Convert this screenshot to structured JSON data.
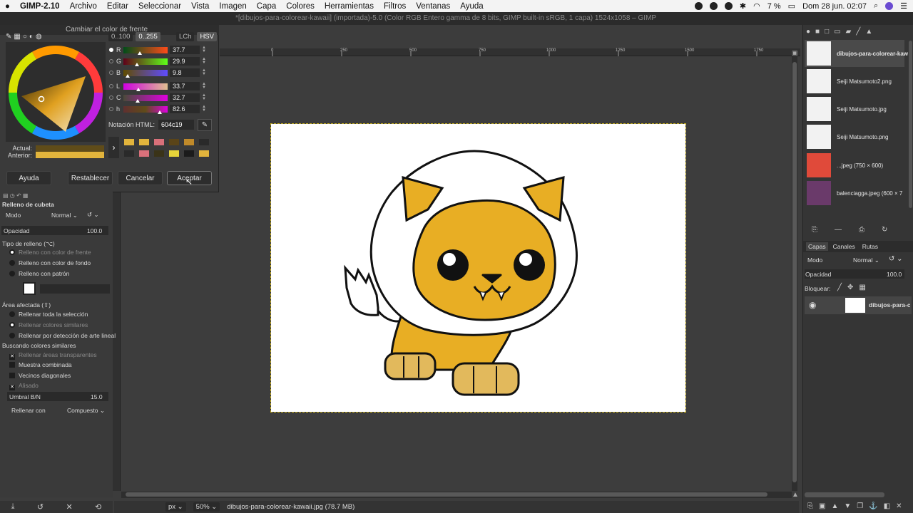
{
  "menubar": {
    "apple": "",
    "app": "GIMP-2.10",
    "items": [
      "Archivo",
      "Editar",
      "Seleccionar",
      "Vista",
      "Imagen",
      "Capa",
      "Colores",
      "Herramientas",
      "Filtros",
      "Ventanas",
      "Ayuda"
    ],
    "battery": "7 %",
    "datetime": "Dom 28 jun.  02:07"
  },
  "window_title": "*[dibujos-para-colorear-kawaii] (importada)-5.0 (Color RGB Entero gamma de 8 bits, GIMP built-in sRGB, 1 capa) 1524x1058 – GIMP",
  "ruler_ticks": [
    "0",
    "250",
    "500",
    "750",
    "1000",
    "1250",
    "1500",
    "1750"
  ],
  "color_dialog": {
    "title": "Cambiar el color de frente",
    "range_buttons": [
      "0..100",
      "0..255"
    ],
    "mode_buttons": [
      "LCh",
      "HSV"
    ],
    "channels": [
      {
        "label": "R",
        "value": "37.7",
        "fill": 0.377
      },
      {
        "label": "G",
        "value": "29.9",
        "fill": 0.299
      },
      {
        "label": "B",
        "value": "9.8",
        "fill": 0.098
      },
      {
        "label": "L",
        "value": "33.7",
        "fill": 0.337
      },
      {
        "label": "C",
        "value": "32.7",
        "fill": 0.327
      },
      {
        "label": "h",
        "value": "82.6",
        "fill": 0.826
      }
    ],
    "html_label": "Notación HTML:",
    "html_value": "604c19",
    "current_label": "Actual:",
    "previous_label": "Anterior:",
    "current_color": "#604c19",
    "previous_color": "#e2b43c",
    "history_colors": [
      "#e2b43c",
      "#e2b43c",
      "#d9707a",
      "#5a4418",
      "#c08a2a",
      "#2a2a2a",
      "#2a2a2a",
      "#d9707a",
      "#3a3318",
      "#e6d43a",
      "#1b1b1b",
      "#e2b43c"
    ],
    "buttons": {
      "help": "Ayuda",
      "reset": "Restablecer",
      "cancel": "Cancelar",
      "ok": "Aceptar"
    }
  },
  "tool_options": {
    "title": "Relleno de cubeta",
    "mode_label": "Modo",
    "mode_value": "Normal",
    "opacity_label": "Opacidad",
    "opacity_value": "100.0",
    "fill_type_label": "Tipo de relleno  (⌥)",
    "fill_types": [
      "Relleno con color de frente",
      "Relleno con color de fondo",
      "Relleno con patrón"
    ],
    "area_label": "Área afectada  (⇧)",
    "areas": [
      "Rellenar toda la selección",
      "Rellenar colores similares",
      "Rellenar por detección de arte lineal"
    ],
    "search_label": "Buscando colores similares",
    "checks": [
      "Rellenar áreas transparentes",
      "Muestra combinada",
      "Vecinos diagonales",
      "Alisado"
    ],
    "threshold_label": "Umbral B/N",
    "threshold_value": "15.0",
    "fill_with_label": "Rellenar con",
    "fill_with_value": "Compuesto"
  },
  "images_dock": {
    "items": [
      {
        "name": "dibujos-para-colorear-kawa"
      },
      {
        "name": "Seiji Matsumoto2.png"
      },
      {
        "name": "Seiji Matsumoto.jpg"
      },
      {
        "name": "Seiji Matsumoto.png"
      },
      {
        "name": "...jpeg (750 × 600)"
      },
      {
        "name": "balenciagga.jpeg (600 × 7"
      }
    ]
  },
  "layers_dock": {
    "tabs": [
      "Capas",
      "Canales",
      "Rutas"
    ],
    "mode_label": "Modo",
    "mode_value": "Normal",
    "opacity_label": "Opacidad",
    "opacity_value": "100.0",
    "lock_label": "Bloquear:",
    "layer_name": "dibujos-para-colo"
  },
  "statusbar": {
    "unit": "px",
    "zoom": "50%",
    "info": "dibujos-para-colorear-kawaii.jpg (78.7 MB)"
  },
  "colors": {
    "lion_fill": "#e8ae24",
    "lion_paw": "#e2b95c",
    "outline": "#111111"
  }
}
